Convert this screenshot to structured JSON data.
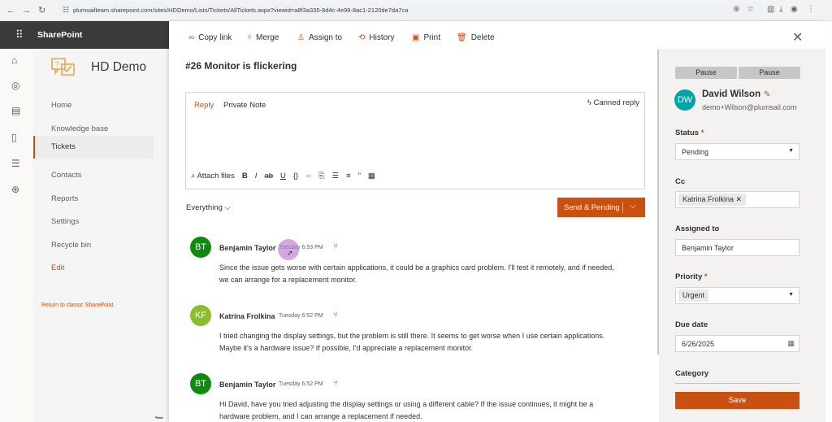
{
  "browser": {
    "url": "plumsailteam.sharepoint.com/sites/HDDemo/Lists/Tickets/AllTickets.aspx?viewid=a8f3a335-8d4c-4e99-8ac1-2120de7da7ca"
  },
  "suite": {
    "app_name": "SharePoint"
  },
  "site": {
    "title": "HD Demo"
  },
  "nav": {
    "items": [
      "Home",
      "Knowledge base",
      "Tickets",
      "Contacts",
      "Reports",
      "Settings",
      "Recycle bin",
      "Edit"
    ],
    "active": "Tickets",
    "classic_link": "Return to classic SharePoint"
  },
  "commands": {
    "copy_link": "Copy link",
    "merge": "Merge",
    "assign_to": "Assign to",
    "history": "History",
    "print": "Print",
    "delete": "Delete"
  },
  "ticket": {
    "title": "#26  Monitor is flickering"
  },
  "editor": {
    "reply_tab": "Reply",
    "note_tab": "Private Note",
    "canned_reply": "Canned reply",
    "attach_files": "Attach files"
  },
  "filter": {
    "label": "Everything"
  },
  "send_button": {
    "label": "Send & Pending"
  },
  "messages": [
    {
      "initials": "BT",
      "author": "Benjamin Taylor",
      "time": "Tuesday 6:53 PM",
      "body": "Since the issue gets worse with certain applications, it could be a graphics card problem. I'll test it remotely, and if needed, we can arrange for a replacement monitor.",
      "color": "#0f8a0f"
    },
    {
      "initials": "KF",
      "author": "Katrina Frolkina",
      "time": "Tuesday 6:52 PM",
      "body": "I tried changing the display settings, but the problem is still there. It seems to get worse when I use certain applications. Maybe it's a hardware issue? If possible, I'd appreciate a replacement monitor.",
      "color": "#8cbd2c"
    },
    {
      "initials": "BT",
      "author": "Benjamin Taylor",
      "time": "Tuesday 6:52 PM",
      "body": "Hi David, have you tried adjusting the display settings or using a different cable? If the issue continues, it might be a hardware problem, and I can arrange a replacement if needed.",
      "color": "#0f8a0f"
    }
  ],
  "sidebar": {
    "pause_left": "Pause",
    "pause_right": "Pause",
    "user": {
      "initials": "DW",
      "name": "David Wilson",
      "email": "demo+Wilson@plumsail.com",
      "color": "#00a3a8"
    },
    "status": {
      "label": "Status",
      "required_mark": "*",
      "value": "Pending"
    },
    "cc": {
      "label": "Cc",
      "tag": "Katrina Frolkina"
    },
    "assigned_to": {
      "label": "Assigned to",
      "value": "Benjamin Taylor"
    },
    "priority": {
      "label": "Priority",
      "required_mark": "*",
      "value": "Urgent"
    },
    "due_date": {
      "label": "Due date",
      "value": "6/26/2025"
    },
    "category": {
      "label": "Category"
    },
    "save_label": "Save"
  },
  "colors": {
    "accent": "#ca5010",
    "suite_bar": "#3b3a39"
  }
}
